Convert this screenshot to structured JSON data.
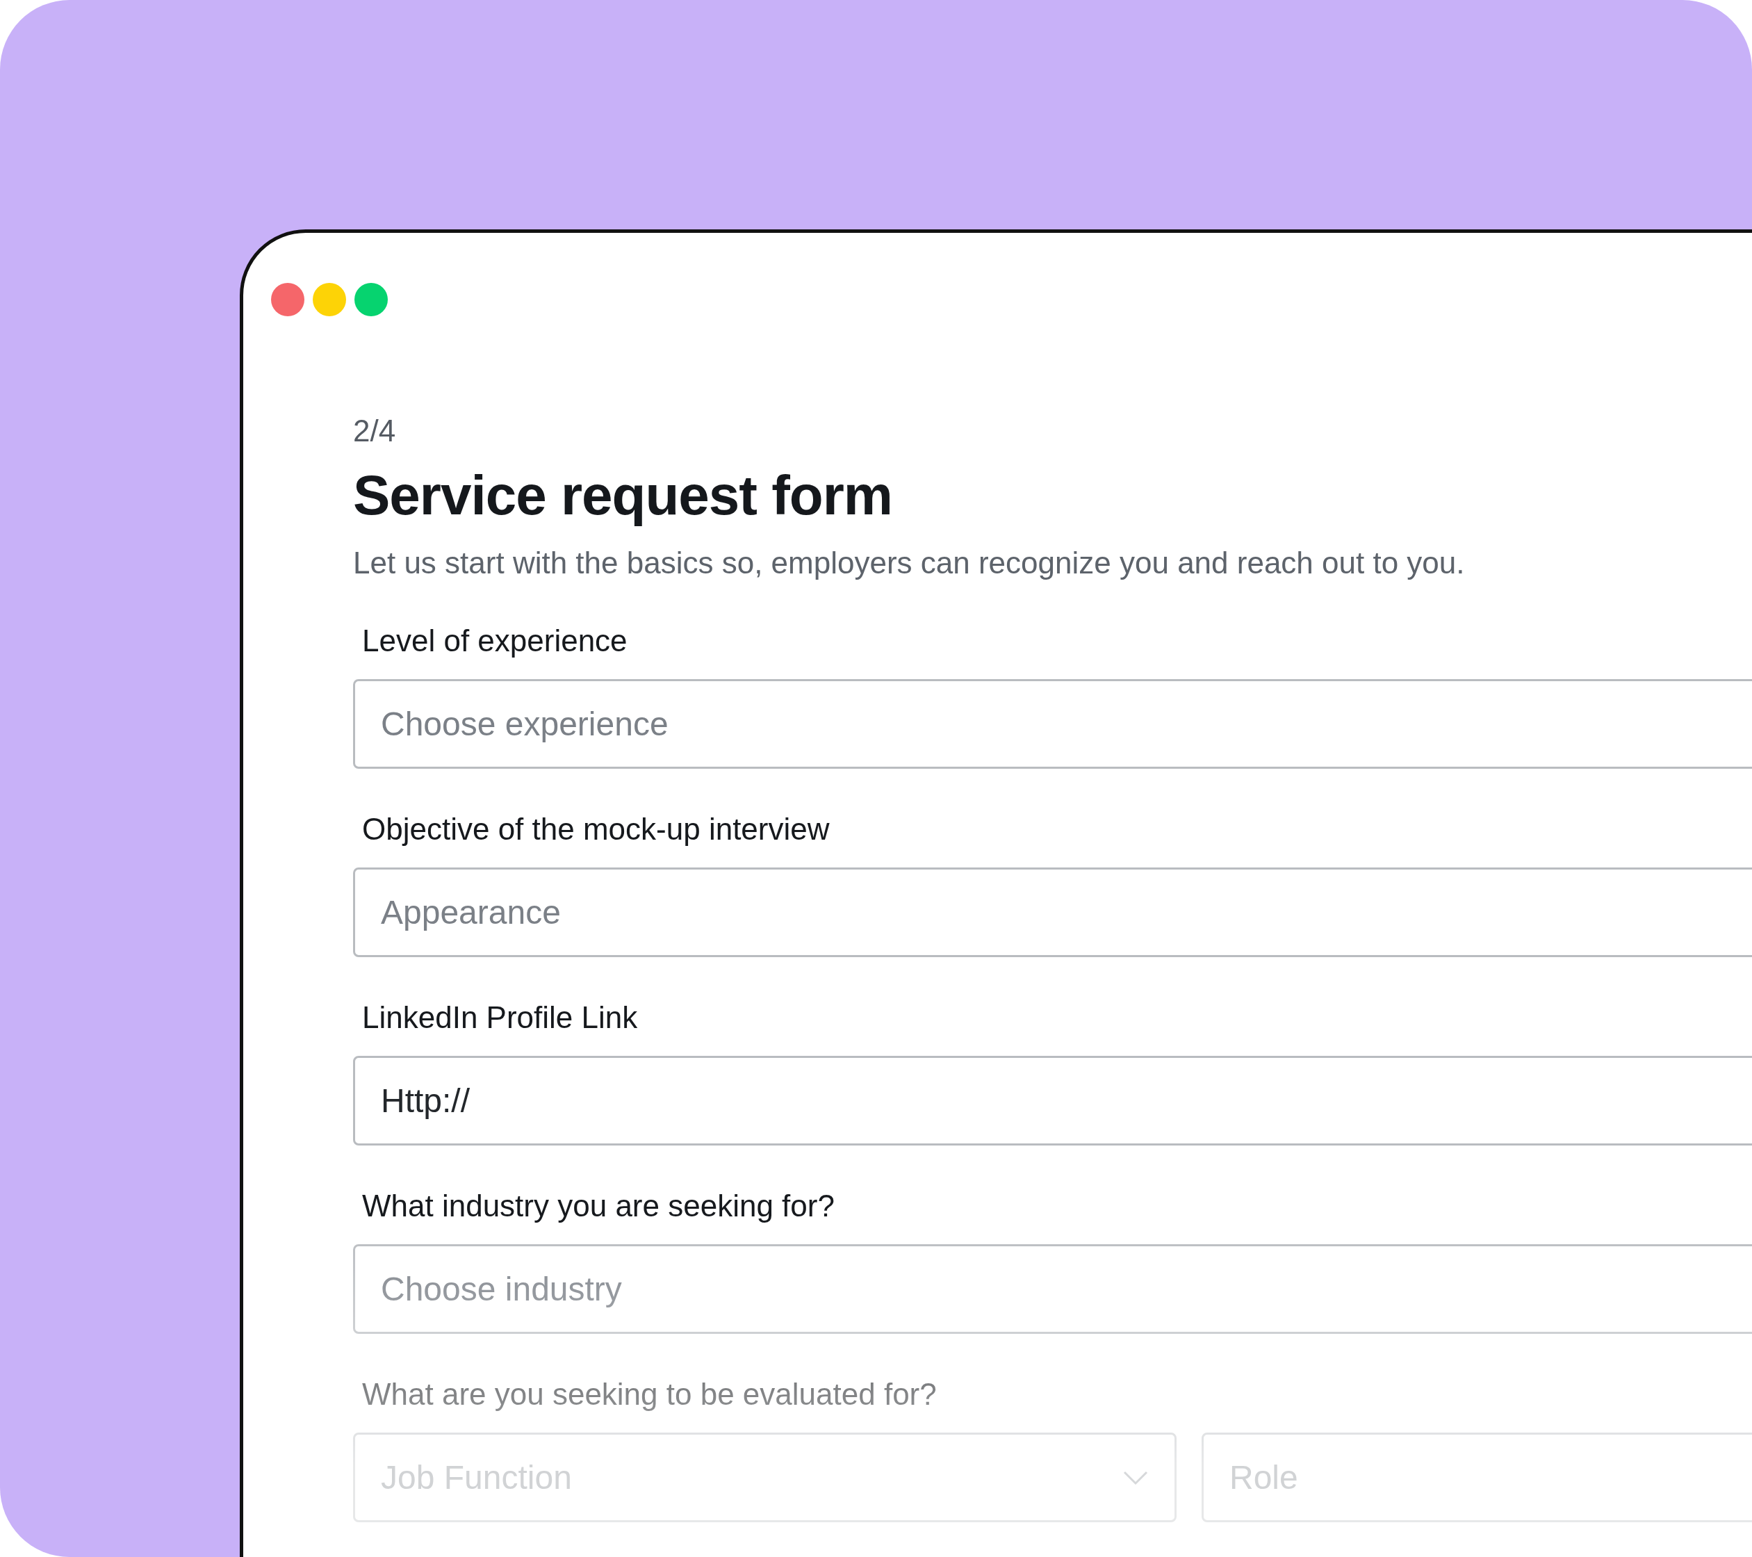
{
  "window": {
    "controls": [
      {
        "color": "#f5666a"
      },
      {
        "color": "#fdd306"
      },
      {
        "color": "#06d36f"
      }
    ]
  },
  "form": {
    "step": "2/4",
    "title": "Service request form",
    "subtitle": "Let us start with the basics so, employers can recognize you and reach out to you.",
    "fields": [
      {
        "label": "Level of experience",
        "inputs": [
          {
            "kind": "select",
            "placeholder": "Choose experience"
          }
        ]
      },
      {
        "label": "Objective of the mock-up interview",
        "inputs": [
          {
            "kind": "select",
            "placeholder": "Appearance"
          }
        ]
      },
      {
        "label": "LinkedIn Profile Link",
        "inputs": [
          {
            "kind": "text",
            "value": "Http://"
          }
        ]
      },
      {
        "label": "What industry you are seeking for?",
        "inputs": [
          {
            "kind": "select",
            "placeholder": "Choose industry"
          }
        ]
      },
      {
        "label": "What are you seeking to be evaluated for?",
        "inputs": [
          {
            "kind": "dropdown",
            "placeholder": "Job Function"
          },
          {
            "kind": "text",
            "placeholder": "Role"
          }
        ]
      }
    ]
  }
}
